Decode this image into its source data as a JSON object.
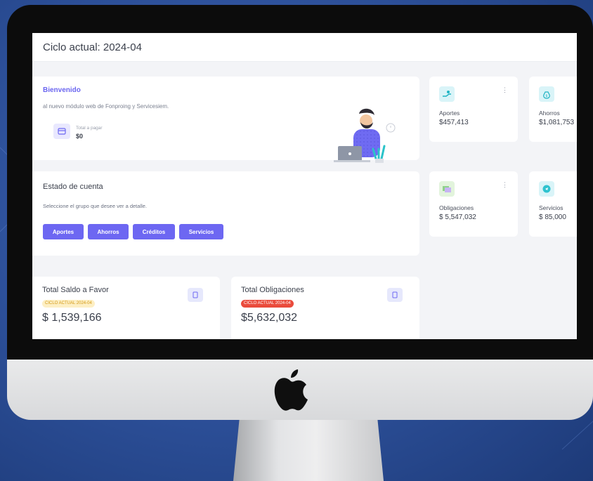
{
  "header": {
    "title": "Ciclo actual: 2024-04"
  },
  "welcome": {
    "title": "Bienvenido",
    "subtitle": "al nuevo módulo web de Fonproing y Servicesiem.",
    "pay_label": "Total a pagar",
    "pay_value": "$0"
  },
  "stats": {
    "aportes": {
      "label": "Aportes",
      "value": "$457,413",
      "icon": "hand-money-icon"
    },
    "ahorros": {
      "label": "Ahorros",
      "value": "$1,081,753",
      "icon": "money-bag-icon"
    },
    "obligaciones": {
      "label": "Obligaciones",
      "value": "$ 5,547,032",
      "icon": "bills-icon"
    },
    "servicios": {
      "label": "Servicios",
      "value": "$ 85,000",
      "icon": "services-icon"
    }
  },
  "estado": {
    "title": "Estado de cuenta",
    "subtitle": "Seleccione el grupo que desee ver a detalle.",
    "buttons": [
      "Aportes",
      "Ahorros",
      "Créditos",
      "Servicios"
    ]
  },
  "totals": {
    "favor": {
      "title": "Total Saldo a Favor",
      "badge": "CICLO ACTUAL 2024-04",
      "value": "$ 1,539,166"
    },
    "obligaciones": {
      "title": "Total Obligaciones",
      "badge": "CICLO ACTUAL 2024-04",
      "value": "$5,632,032"
    }
  },
  "colors": {
    "accent": "#6d67f2",
    "badge_yellow_bg": "#fdefc4",
    "badge_yellow_text": "#d49a17",
    "badge_red_bg": "#ea4b3c",
    "badge_red_text": "#ffffff"
  }
}
